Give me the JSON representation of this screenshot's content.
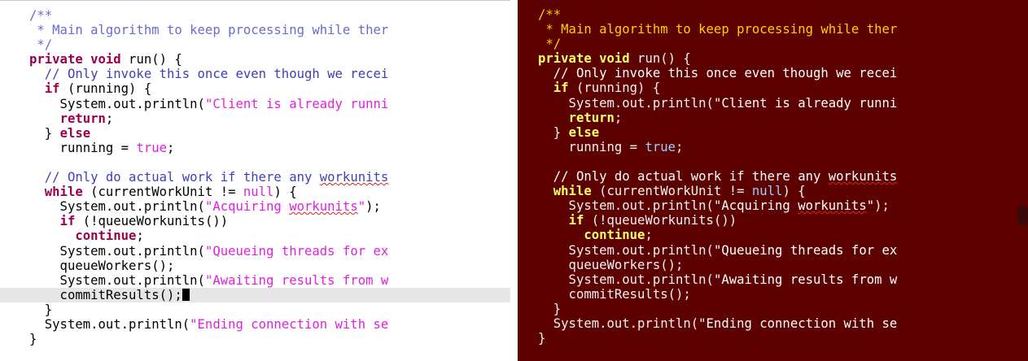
{
  "theme_colors": {
    "light_bg": "#ffffff",
    "dark_bg": "#5c0000",
    "current_line": "#e6e6e6"
  },
  "code_lines": [
    {
      "indent": 0,
      "tokens": [
        {
          "t": "/**",
          "k": "doc"
        }
      ]
    },
    {
      "indent": 0,
      "tokens": [
        {
          "t": " * Main algorithm to keep processing while ther",
          "k": "doc"
        }
      ]
    },
    {
      "indent": 0,
      "tokens": [
        {
          "t": " */",
          "k": "doc"
        }
      ]
    },
    {
      "indent": 0,
      "tokens": [
        {
          "t": "private",
          "k": "keyword"
        },
        {
          "t": " ",
          "k": "plain"
        },
        {
          "t": "void",
          "k": "keyword"
        },
        {
          "t": " run() {",
          "k": "plain"
        }
      ]
    },
    {
      "indent": 0,
      "tokens": [
        {
          "t": "  // Only invoke this once even though we recei",
          "k": "comment"
        }
      ]
    },
    {
      "indent": 0,
      "tokens": [
        {
          "t": "  ",
          "k": "plain"
        },
        {
          "t": "if",
          "k": "keyword"
        },
        {
          "t": " (running) {",
          "k": "plain"
        }
      ]
    },
    {
      "indent": 0,
      "tokens": [
        {
          "t": "    System.out.println(",
          "k": "plain"
        },
        {
          "t": "\"Client is already runni",
          "k": "string"
        }
      ]
    },
    {
      "indent": 0,
      "tokens": [
        {
          "t": "    ",
          "k": "plain"
        },
        {
          "t": "return",
          "k": "keyword"
        },
        {
          "t": ";",
          "k": "plain"
        }
      ]
    },
    {
      "indent": 0,
      "tokens": [
        {
          "t": "  } ",
          "k": "plain"
        },
        {
          "t": "else",
          "k": "keyword"
        }
      ]
    },
    {
      "indent": 0,
      "tokens": [
        {
          "t": "    running = ",
          "k": "plain"
        },
        {
          "t": "true",
          "k": "literal"
        },
        {
          "t": ";",
          "k": "plain"
        }
      ]
    },
    {
      "indent": 0,
      "tokens": [
        {
          "t": "",
          "k": "plain"
        }
      ]
    },
    {
      "indent": 0,
      "tokens": [
        {
          "t": "  // Only do actual work if there any ",
          "k": "comment"
        },
        {
          "t": "workunits",
          "k": "comment",
          "spell": true
        }
      ]
    },
    {
      "indent": 0,
      "tokens": [
        {
          "t": "  ",
          "k": "plain"
        },
        {
          "t": "while",
          "k": "keyword"
        },
        {
          "t": " (currentWorkUnit != ",
          "k": "plain"
        },
        {
          "t": "null",
          "k": "literal"
        },
        {
          "t": ") {",
          "k": "plain"
        }
      ]
    },
    {
      "indent": 0,
      "tokens": [
        {
          "t": "    System.out.println(",
          "k": "plain"
        },
        {
          "t": "\"Acquiring ",
          "k": "string"
        },
        {
          "t": "workunits",
          "k": "string",
          "spell": true
        },
        {
          "t": "\"",
          "k": "string"
        },
        {
          "t": ");",
          "k": "plain"
        }
      ]
    },
    {
      "indent": 0,
      "tokens": [
        {
          "t": "    ",
          "k": "plain"
        },
        {
          "t": "if",
          "k": "keyword"
        },
        {
          "t": " (!queueWorkunits())",
          "k": "plain"
        }
      ]
    },
    {
      "indent": 0,
      "tokens": [
        {
          "t": "      ",
          "k": "plain"
        },
        {
          "t": "continue",
          "k": "keyword"
        },
        {
          "t": ";",
          "k": "plain"
        }
      ]
    },
    {
      "indent": 0,
      "tokens": [
        {
          "t": "    System.out.println(",
          "k": "plain"
        },
        {
          "t": "\"Queueing threads for ex",
          "k": "string"
        }
      ]
    },
    {
      "indent": 0,
      "tokens": [
        {
          "t": "    queueWorkers();",
          "k": "plain"
        }
      ]
    },
    {
      "indent": 0,
      "tokens": [
        {
          "t": "    System.out.println(",
          "k": "plain"
        },
        {
          "t": "\"Awaiting results from w",
          "k": "string"
        }
      ]
    },
    {
      "indent": 0,
      "current": true,
      "tokens": [
        {
          "t": "    commitResults();",
          "k": "plain"
        }
      ]
    },
    {
      "indent": 0,
      "tokens": [
        {
          "t": "  }",
          "k": "plain"
        }
      ]
    },
    {
      "indent": 0,
      "tokens": [
        {
          "t": "  System.out.println(",
          "k": "plain"
        },
        {
          "t": "\"Ending connection with se",
          "k": "string"
        }
      ]
    },
    {
      "indent": 0,
      "tokens": [
        {
          "t": "}",
          "k": "plain"
        }
      ]
    }
  ]
}
